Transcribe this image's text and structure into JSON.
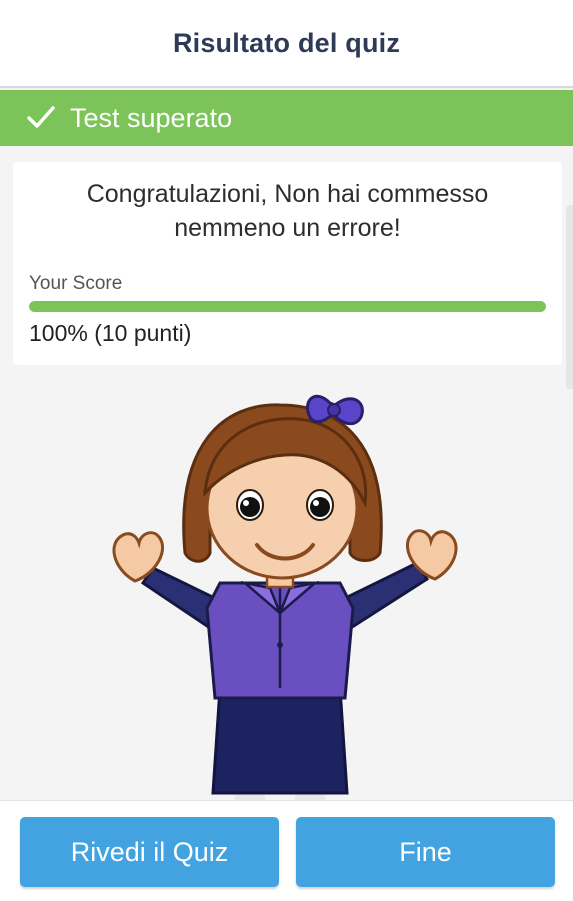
{
  "header": {
    "title": "Risultato del quiz"
  },
  "banner": {
    "text": "Test superato",
    "icon": "check-icon",
    "color": "#7cc35a"
  },
  "result": {
    "message_line1": "Congratulazioni, Non hai commesso",
    "message_line2": "nemmeno un errore!",
    "score_label": "Your Score",
    "score_fraction": 1.0,
    "score_text": "100% (10 punti)",
    "bar_color": "#7cc35a"
  },
  "illustration": {
    "name": "celebrating-girl-cartoon"
  },
  "buttons": {
    "review_label": "Rivedi il Quiz",
    "done_label": "Fine",
    "color": "#42a3e0"
  }
}
